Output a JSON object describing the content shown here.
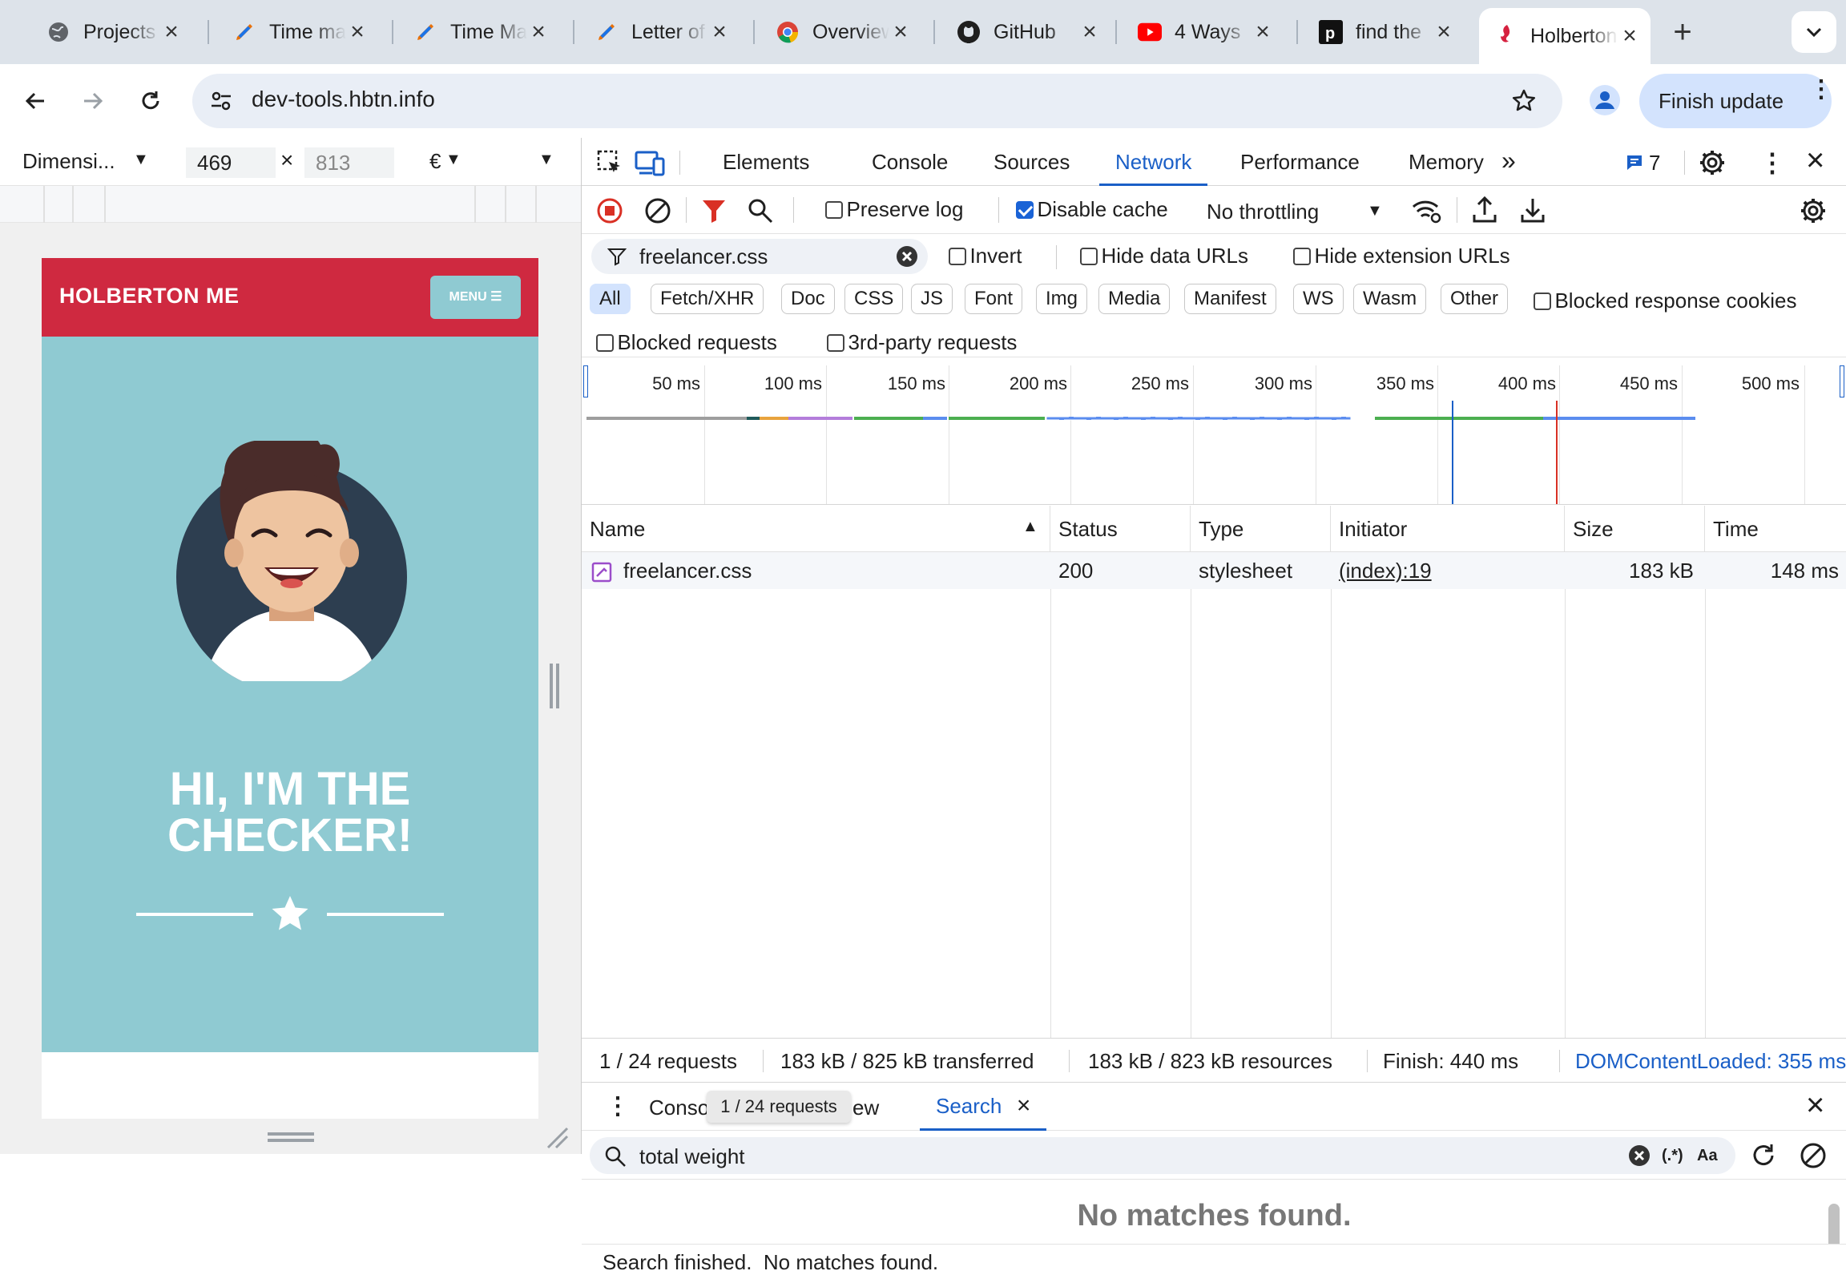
{
  "browser": {
    "tabs": [
      {
        "title": "Projects",
        "icon": "globe-icon"
      },
      {
        "title": "Time management",
        "icon": "pen-icon"
      },
      {
        "title": "Time Management",
        "icon": "pen-icon"
      },
      {
        "title": "Letter of",
        "icon": "pen-icon"
      },
      {
        "title": "Overview",
        "icon": "chrome-icon"
      },
      {
        "title": "GitHub",
        "icon": "github-icon"
      },
      {
        "title": "4 Ways",
        "icon": "youtube-icon"
      },
      {
        "title": "find the",
        "icon": "perplexity-icon"
      },
      {
        "title": "Holberton",
        "icon": "holberton-icon"
      }
    ],
    "url": "dev-tools.hbtn.info",
    "finish_update": "Finish update"
  },
  "device": {
    "dimensions_label": "Dimensi...",
    "width": "469",
    "height_placeholder": "813",
    "zoom": "€"
  },
  "site": {
    "brand": "HOLBERTON ME",
    "menu_label": "MENU",
    "hero_line1": "HI, I'M THE",
    "hero_line2": "CHECKER!"
  },
  "devtools": {
    "tabs": [
      "Elements",
      "Console",
      "Sources",
      "Network",
      "Performance",
      "Memory"
    ],
    "issues_count": "7",
    "throttling": "No throttling",
    "filter_value": "freelancer.css",
    "checkboxes": {
      "preserve_log": "Preserve log",
      "disable_cache": "Disable cache",
      "invert": "Invert",
      "hide_data_urls": "Hide data URLs",
      "hide_extension_urls": "Hide extension URLs",
      "blocked_response_cookies": "Blocked response cookies",
      "blocked_requests": "Blocked requests",
      "third_party_requests": "3rd-party requests"
    },
    "type_filters": [
      "All",
      "Fetch/XHR",
      "Doc",
      "CSS",
      "JS",
      "Font",
      "Img",
      "Media",
      "Manifest",
      "WS",
      "Wasm",
      "Other"
    ],
    "timeline_ticks": [
      "50 ms",
      "100 ms",
      "150 ms",
      "200 ms",
      "250 ms",
      "300 ms",
      "350 ms",
      "400 ms",
      "450 ms",
      "500 ms"
    ],
    "columns": [
      "Name",
      "Status",
      "Type",
      "Initiator",
      "Size",
      "Time"
    ],
    "requests": [
      {
        "name": "freelancer.css",
        "status": "200",
        "type": "stylesheet",
        "initiator": "(index):19",
        "size": "183 kB",
        "time": "148 ms"
      }
    ],
    "summary": {
      "requests": "1 / 24 requests",
      "transferred": "183 kB / 825 kB transferred",
      "resources": "183 kB / 823 kB resources",
      "finish": "Finish: 440 ms",
      "dcl": "DOMContentLoaded: 355 ms"
    },
    "drawer": {
      "tab_console": "Console",
      "tab_overview_tail": "ew",
      "tooltip": "1 / 24 requests",
      "tab_search": "Search",
      "search_value": "total weight",
      "regex_label": "(.*)",
      "case_label": "Aa",
      "no_matches": "No matches found.",
      "status": "Search finished.  No matches found."
    },
    "colors": {
      "accent": "#1a5fc7",
      "record": "#d93025",
      "filter_active": "#d93025"
    }
  }
}
